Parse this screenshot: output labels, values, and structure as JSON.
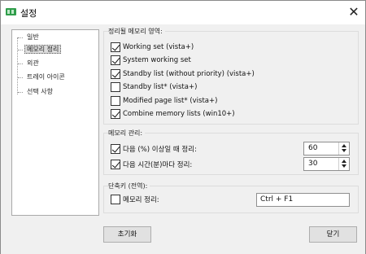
{
  "window": {
    "title": "설정",
    "close_glyph": "✕"
  },
  "nav": {
    "items": [
      {
        "label": "일반",
        "selected": false
      },
      {
        "label": "메모리 정리",
        "selected": true
      },
      {
        "label": "외관",
        "selected": false
      },
      {
        "label": "트레이 아이콘",
        "selected": false
      },
      {
        "label": "선택 사항",
        "selected": false
      }
    ]
  },
  "memory_areas": {
    "title": "정리될 메모리 영역:",
    "options": [
      {
        "label": "Working set (vista+)",
        "checked": true
      },
      {
        "label": "System working set",
        "checked": true
      },
      {
        "label": "Standby list (without priority) (vista+)",
        "checked": true
      },
      {
        "label": "Standby list* (vista+)",
        "checked": false
      },
      {
        "label": "Modified page list* (vista+)",
        "checked": false
      },
      {
        "label": "Combine memory lists (win10+)",
        "checked": true
      }
    ]
  },
  "memory_management": {
    "title": "메모리 관리:",
    "percent_rule": {
      "label": "다음 (%) 이상일 때 정리:",
      "checked": true,
      "value": "60"
    },
    "interval_rule": {
      "label": "다음 시간(분)마다 정리:",
      "checked": true,
      "value": "30"
    }
  },
  "hotkey": {
    "title": "단축키 (전역):",
    "clean_label": "메모리 정리:",
    "checked": false,
    "value": "Ctrl + F1"
  },
  "buttons": {
    "reset": "초기화",
    "close": "닫기"
  },
  "icons": {
    "app": "memory-chip-icon",
    "close": "close-icon"
  }
}
